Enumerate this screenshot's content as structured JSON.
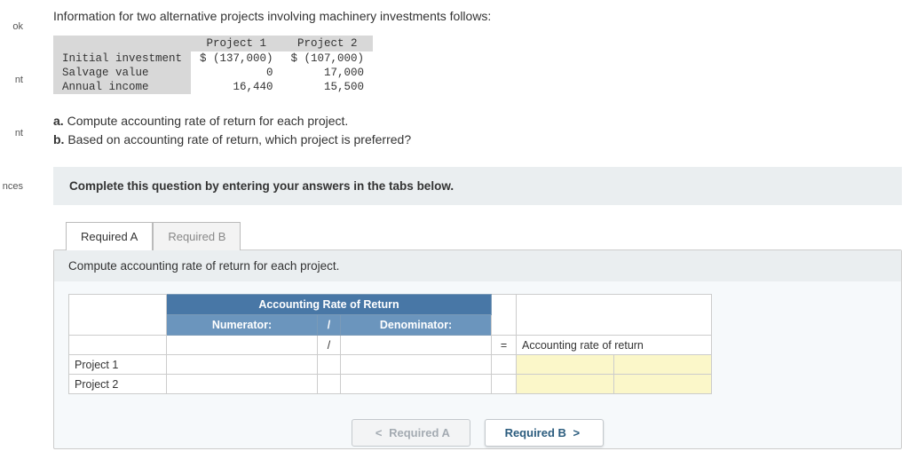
{
  "sidebar": {
    "items": [
      "ok",
      "nt",
      "nt",
      "nces"
    ]
  },
  "intro": "Information for two alternative projects involving machinery investments follows:",
  "data_table": {
    "headers": [
      "",
      "Project 1",
      "Project 2"
    ],
    "rows": [
      {
        "label": "Initial investment",
        "p1": "$ (137,000)",
        "p2": "$ (107,000)"
      },
      {
        "label": "Salvage value",
        "p1": "0",
        "p2": "17,000"
      },
      {
        "label": "Annual income",
        "p1": "16,440",
        "p2": "15,500"
      }
    ]
  },
  "questions": {
    "a_prefix": "a.",
    "a_text": "Compute accounting rate of return for each project.",
    "b_prefix": "b.",
    "b_text": "Based on accounting rate of return, which project is preferred?"
  },
  "hint": "Complete this question by entering your answers in the tabs below.",
  "tabs": {
    "a": "Required A",
    "b": "Required B"
  },
  "panel_text": "Compute accounting rate of return for each project.",
  "answer_table": {
    "top_header": "Accounting Rate of Return",
    "numer": "Numerator:",
    "slash": "/",
    "denom": "Denominator:",
    "eq": "=",
    "result_label": "Accounting rate of return",
    "rows": [
      "Project 1",
      "Project 2"
    ]
  },
  "nav": {
    "prev": "Required A",
    "next": "Required B",
    "lt": "<",
    "gt": ">"
  }
}
